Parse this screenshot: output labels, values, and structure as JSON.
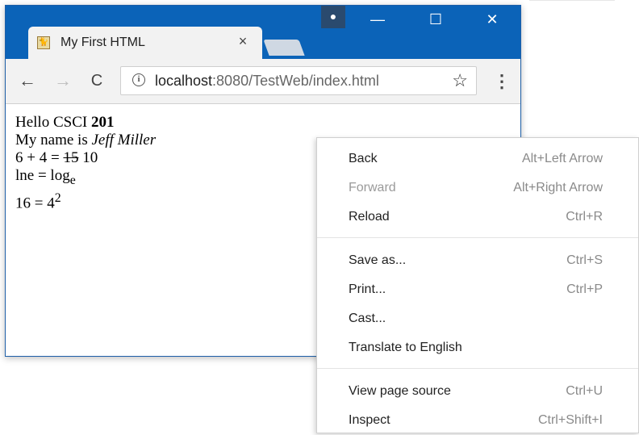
{
  "browser": {
    "tab_title": "My First HTML",
    "tab_close": "×",
    "url_host": "localhost",
    "url_rest": ":8080/TestWeb/index.html",
    "buttons": {
      "back": "←",
      "forward": "→",
      "reload": "C",
      "minimize": "—",
      "maximize": "☐",
      "close": "✕",
      "star": "☆",
      "menu": "⋮"
    }
  },
  "page": {
    "line1_a": "Hello CSCI ",
    "line1_b": "201",
    "line2_a": "My name is ",
    "line2_b": "Jeff Miller",
    "line3_a": "6 + 4 = ",
    "line3_strike": "15",
    "line3_b": " 10",
    "line4_a": "lne = log",
    "line4_sub": "e",
    "line5_a": "16 = 4",
    "line5_sup": "2"
  },
  "context_menu": {
    "groups": [
      [
        {
          "label": "Back",
          "shortcut": "Alt+Left Arrow",
          "disabled": false
        },
        {
          "label": "Forward",
          "shortcut": "Alt+Right Arrow",
          "disabled": true
        },
        {
          "label": "Reload",
          "shortcut": "Ctrl+R",
          "disabled": false
        }
      ],
      [
        {
          "label": "Save as...",
          "shortcut": "Ctrl+S",
          "disabled": false
        },
        {
          "label": "Print...",
          "shortcut": "Ctrl+P",
          "disabled": false
        },
        {
          "label": "Cast...",
          "shortcut": "",
          "disabled": false
        },
        {
          "label": "Translate to English",
          "shortcut": "",
          "disabled": false
        }
      ],
      [
        {
          "label": "View page source",
          "shortcut": "Ctrl+U",
          "disabled": false
        },
        {
          "label": "Inspect",
          "shortcut": "Ctrl+Shift+I",
          "disabled": false
        }
      ]
    ]
  },
  "colors": {
    "titlebar": "#0b63b8",
    "toolbar": "#f2f2f2",
    "disabled_text": "#9a9a9a",
    "shortcut_text": "#8a8a8a"
  }
}
